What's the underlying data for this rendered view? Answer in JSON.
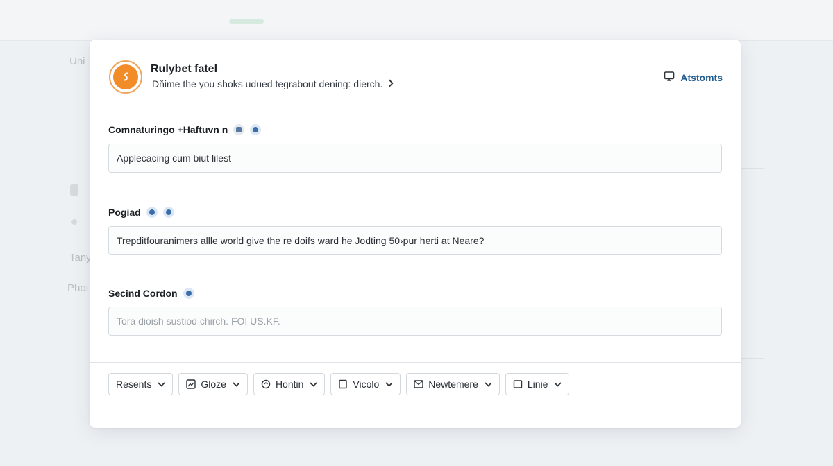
{
  "background": {
    "labels": [
      "Uni",
      "Tany",
      "Phoi"
    ]
  },
  "header": {
    "title": "Rulybet fatel",
    "subtitle": "Dňime the you shoks udued tegrabout dening: dierch.",
    "action_label": "Atstomts",
    "action_icon": "monitor-icon",
    "logo_icon": "orange-logo-icon"
  },
  "fields": [
    {
      "label": "Comnaturingo +Haftuvn n",
      "value": "Applecacing cum biut lilest"
    },
    {
      "label": "Pogiad",
      "value": "Trepditfouranimers allle world give the re doifs ward he Jodting 50›pur herti at Neare?"
    },
    {
      "label": "Secind Cordon",
      "value": "Tora dioish sustiod chirch. FOI US.KF."
    }
  ],
  "toolbar": [
    {
      "label": "Resents",
      "icon": ""
    },
    {
      "label": "Gloze",
      "icon": "image-icon"
    },
    {
      "label": "Hontin",
      "icon": "refresh-icon"
    },
    {
      "label": "Vicolo",
      "icon": "square-icon"
    },
    {
      "label": "Newtemere",
      "icon": "mail-image-icon"
    },
    {
      "label": "Linie",
      "icon": "square-icon"
    }
  ],
  "colors": {
    "accent": "#215c8e",
    "logo": "#f28c28",
    "badge": "#3b6ea8"
  }
}
